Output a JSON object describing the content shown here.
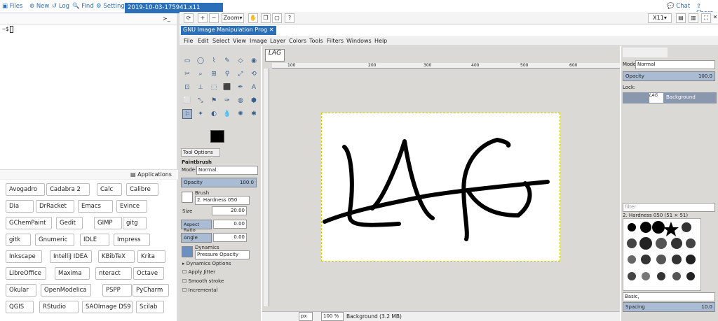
{
  "topbar": {
    "files": "Files",
    "new": "New",
    "log": "Log",
    "find": "Find",
    "settings": "Settings",
    "tab_title": "2019-10-03-175941.x11",
    "chat": "Chat",
    "share": "Share"
  },
  "terminal": {
    "prompt": "~$"
  },
  "apps_header": "Applications",
  "apps": [
    "Avogadro",
    "Cadabra 2",
    "Calc",
    "Calibre",
    "Dia",
    "DrRacket",
    "Emacs",
    "Evince",
    "GChemPaint",
    "Gedit",
    "GIMP",
    "gitg",
    "gitk",
    "Gnumeric",
    "IDLE",
    "Impress",
    "Inkscape",
    "IntelliJ IDEA",
    "KBibTeX",
    "Krita",
    "LibreOffice",
    "Maxima",
    "nteract",
    "Octave",
    "Okular",
    "OpenModelica",
    "PSPP",
    "PyCharm",
    "QGIS",
    "RStudio",
    "SAOImage DS9",
    "Scilab"
  ],
  "viewer_toolbar": {
    "zoom": "Zoom",
    "x11": "X11"
  },
  "gimp": {
    "title": "GNU Image Manipulation Prog",
    "menu": [
      "File",
      "Edit",
      "Select",
      "View",
      "Image",
      "Layer",
      "Colors",
      "Tools",
      "Filters",
      "Windows",
      "Help"
    ],
    "image_tab": "LAG",
    "ruler": [
      "100",
      "200",
      "300",
      "400",
      "500",
      "600"
    ],
    "tool_options": {
      "tab": "Tool Options",
      "tool": "Paintbrush",
      "mode_label": "Mode:",
      "mode": "Normal",
      "opacity_label": "Opacity",
      "opacity": "100.0",
      "brush_label": "Brush",
      "brush": "2. Hardness 050",
      "size_label": "Size",
      "size": "20.00",
      "aspect_label": "Aspect Ratio",
      "aspect": "0.00",
      "angle_label": "Angle",
      "angle": "0.00",
      "dynamics_label": "Dynamics",
      "dynamics": "Pressure Opacity",
      "dyn_options": "Dynamics Options",
      "jitter": "Apply Jitter",
      "smooth": "Smooth stroke",
      "incremental": "Incremental"
    },
    "layers": {
      "mode_label": "Mode:",
      "mode": "Normal",
      "opacity_label": "Opacity",
      "opacity": "100.0",
      "lock_label": "Lock:",
      "layer_name": "Background"
    },
    "brushes": {
      "filter": "filter",
      "name": "2. Hardness 050 (51 × 51)",
      "set": "Basic,",
      "spacing_label": "Spacing",
      "spacing": "10.0"
    },
    "status": {
      "unit": "px",
      "zoom": "100 %",
      "info": "Background (3.2 MB)"
    }
  }
}
